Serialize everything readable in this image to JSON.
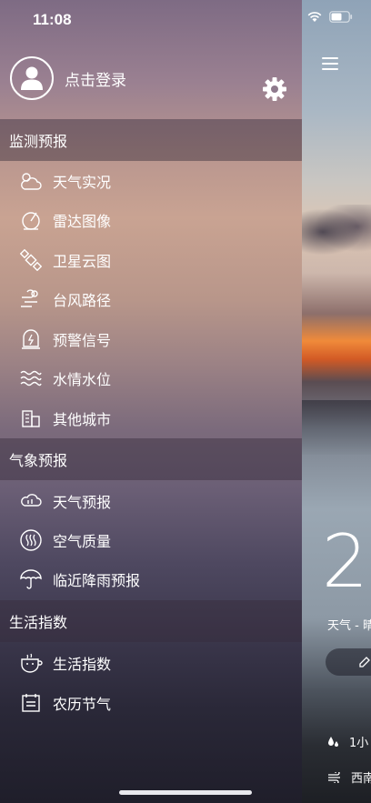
{
  "status_bar": {
    "time": "11:08"
  },
  "profile": {
    "login_label": "点击登录"
  },
  "sections": [
    {
      "title": "监测预报",
      "items": [
        {
          "label": "天气实况",
          "icon": "weather-live-icon"
        },
        {
          "label": "雷达图像",
          "icon": "radar-icon"
        },
        {
          "label": "卫星云图",
          "icon": "satellite-icon"
        },
        {
          "label": "台风路径",
          "icon": "typhoon-icon"
        },
        {
          "label": "预警信号",
          "icon": "warning-signal-icon"
        },
        {
          "label": "水情水位",
          "icon": "water-level-icon"
        },
        {
          "label": "其他城市",
          "icon": "city-icon"
        }
      ]
    },
    {
      "title": "气象预报",
      "items": [
        {
          "label": "天气预报",
          "icon": "forecast-icon"
        },
        {
          "label": "空气质量",
          "icon": "air-quality-icon"
        },
        {
          "label": "临近降雨预报",
          "icon": "umbrella-icon"
        }
      ]
    },
    {
      "title": "生活指数",
      "items": [
        {
          "label": "生活指数",
          "icon": "life-index-icon"
        },
        {
          "label": "农历节气",
          "icon": "calendar-icon"
        }
      ]
    }
  ],
  "weather": {
    "temp": "2",
    "desc": "天气 - 晴",
    "rain_label": "1小",
    "wind_label": "西南"
  }
}
